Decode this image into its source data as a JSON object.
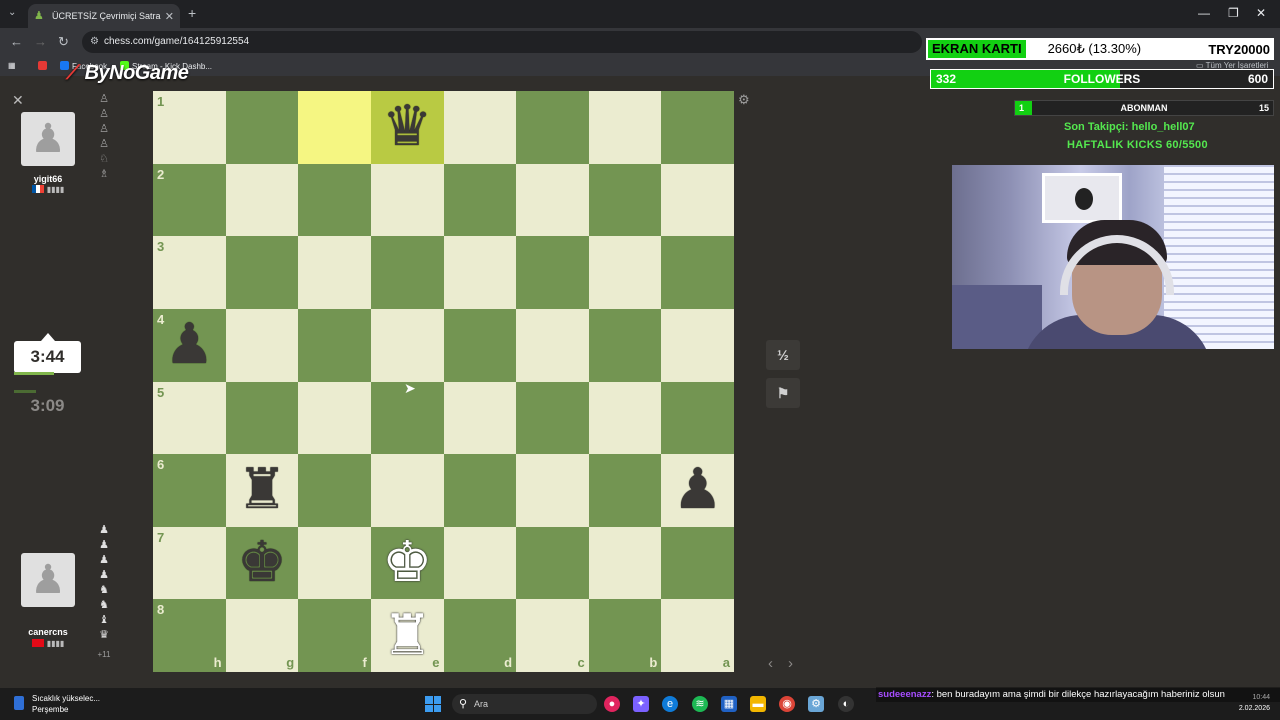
{
  "browser": {
    "tab_title": "ÜCRETSİZ Çevrimiçi Satranç Oy...",
    "url": "chess.com/game/164125912554",
    "bookmarks": [
      "Facebook",
      "Stream - Kick Dashb..."
    ],
    "bookmarks_right": "Tüm Yer İşaretleri",
    "overlay_logo": "ByNoGame"
  },
  "players": {
    "top": {
      "name": "yigit66",
      "clock": "3:09"
    },
    "bottom": {
      "name": "canercns",
      "clock": "3:44",
      "material_adv": "+11"
    }
  },
  "board": {
    "ranks": [
      "1",
      "2",
      "3",
      "4",
      "5",
      "6",
      "7",
      "8"
    ],
    "files": [
      "h",
      "g",
      "f",
      "e",
      "d",
      "c",
      "b",
      "a"
    ],
    "pieces": {
      "e1": "black-queen",
      "h4": "black-pawn",
      "g6": "black-rook",
      "a6": "black-pawn",
      "g7": "black-king",
      "e7": "white-king",
      "e8": "white-rook"
    },
    "highlighted": [
      "f1",
      "e1"
    ]
  },
  "controls": {
    "draw_label": "½",
    "resign_icon": "flag-icon"
  },
  "stream": {
    "ekran_label": "EKRAN KARTI",
    "ekran_value": "2660₺ (13.30%)",
    "ekran_target": "TRY20000",
    "followers_current": "332",
    "followers_label": "FOLLOWERS",
    "followers_goal": "600",
    "followers_progress": 0.553,
    "abonman_current": "1",
    "abonman_label": "ABONMAN",
    "abonman_goal": "15",
    "abonman_progress": 0.067,
    "last_follower": "Son Takipçi: hello_hell07",
    "weekly_kicks": "HAFTALIK KICKS 60/5500"
  },
  "chat": {
    "user": "sudeeenazz",
    "message": ": ben buradayım ama şimdi bir dilekçe hazırlayacağım haberiniz olsun"
  },
  "taskbar": {
    "weather_line1": "Sıcaklık yükselec...",
    "weather_line2": "Perşembe",
    "search_placeholder": "Ara",
    "time": "10:44",
    "date": "2.02.2026"
  },
  "colors": {
    "light": "#ebecd0",
    "dark": "#739552",
    "accent": "#12d012"
  }
}
